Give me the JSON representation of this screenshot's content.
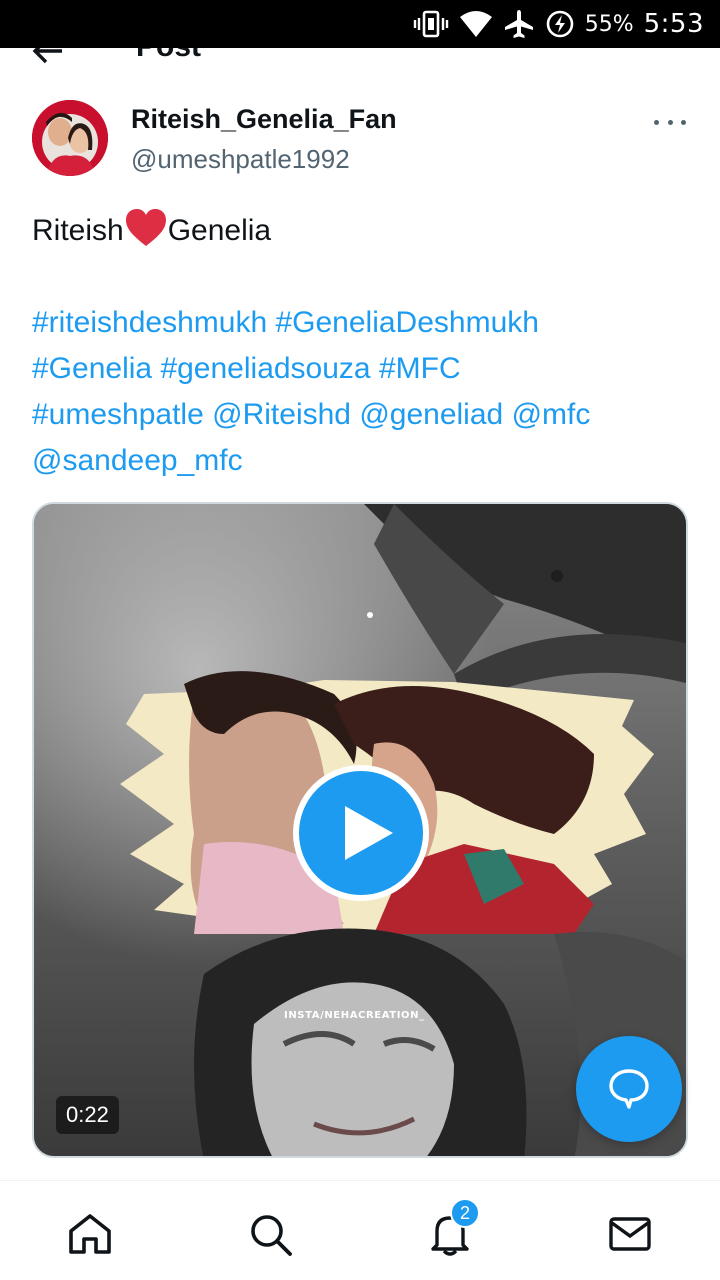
{
  "status_bar": {
    "battery_percent": "55%",
    "time": "5:53",
    "icons": [
      "vibrate-icon",
      "wifi-icon",
      "airplane-icon",
      "battery-charging-icon"
    ]
  },
  "header": {
    "title": "Post",
    "back_icon": "arrow-left-icon"
  },
  "post": {
    "author": {
      "display_name": "Riteish_Genelia_Fan",
      "handle": "@umeshpatle1992"
    },
    "more_icon": "more-horizontal-icon",
    "text": {
      "line1_left": "Riteish",
      "line1_right": "Genelia",
      "tags": {
        "t1": "#riteishdeshmukh",
        "t2": "#GeneliaDeshmukh",
        "t3": "#Genelia",
        "t4": "#geneliadsouza",
        "t5": "#MFC",
        "t6": "#umeshpatle",
        "m1": "@Riteishd",
        "m2": "@geneliad",
        "m3": "@mfc",
        "m4": "@sandeep_mfc"
      }
    },
    "video": {
      "duration": "0:22",
      "watermark": "INSTA/NEHACREATION_",
      "play_icon": "play-icon"
    }
  },
  "fab": {
    "icon": "compose-reply-icon"
  },
  "bottom_nav": {
    "items": [
      {
        "name": "home",
        "icon": "home-icon"
      },
      {
        "name": "search",
        "icon": "search-icon"
      },
      {
        "name": "notifications",
        "icon": "bell-icon",
        "badge": "2"
      },
      {
        "name": "messages",
        "icon": "mail-icon"
      }
    ]
  },
  "colors": {
    "accent": "#1d9bf0",
    "text_primary": "#0f1419",
    "text_secondary": "#536471",
    "heart": "#e0245e"
  }
}
